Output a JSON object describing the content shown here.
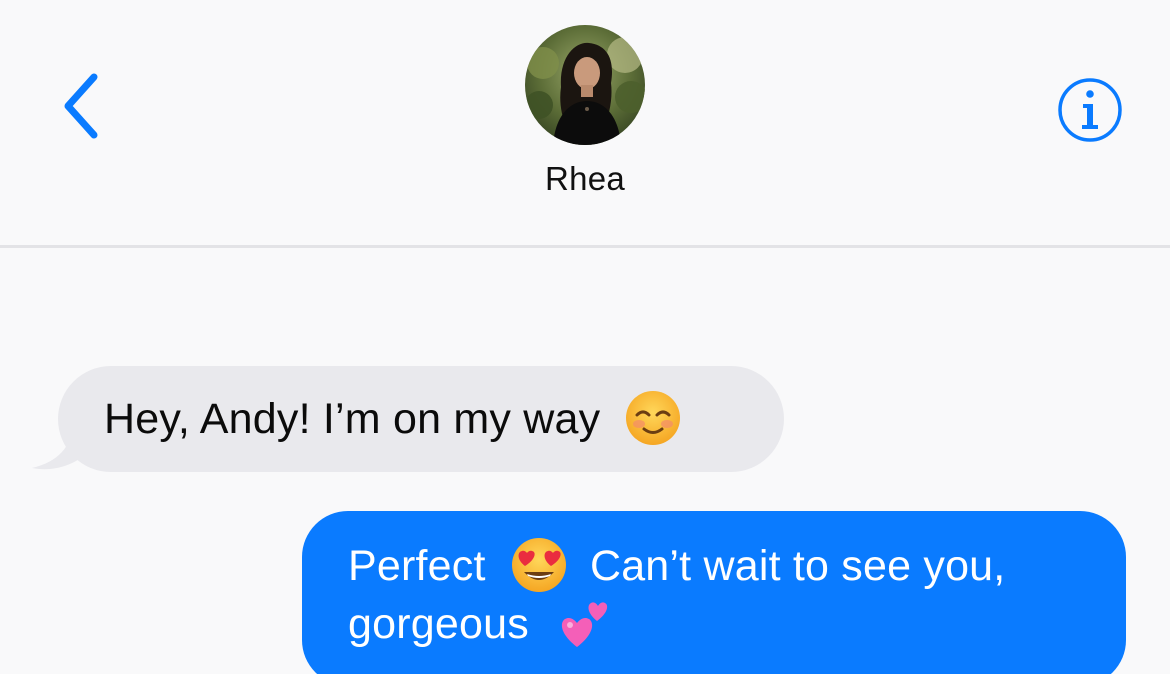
{
  "header": {
    "contact_name": "Rhea",
    "back_icon": "chevron-left-icon",
    "info_icon": "info-icon",
    "accent_color": "#0a7bff"
  },
  "messages": [
    {
      "direction": "incoming",
      "text": "Hey, Andy! I’m on my way",
      "emoji": "smiling-face-icon"
    },
    {
      "direction": "outgoing",
      "line1_text": "Perfect",
      "line1_emoji": "heart-eyes-icon",
      "line1_text2": "Can’t wait to see you,",
      "line2_text": "gorgeous",
      "line2_emoji": "two-hearts-icon"
    }
  ],
  "colors": {
    "incoming_bubble": "#e9e9ed",
    "outgoing_bubble": "#0a7bff",
    "background": "#f9f9fa"
  }
}
